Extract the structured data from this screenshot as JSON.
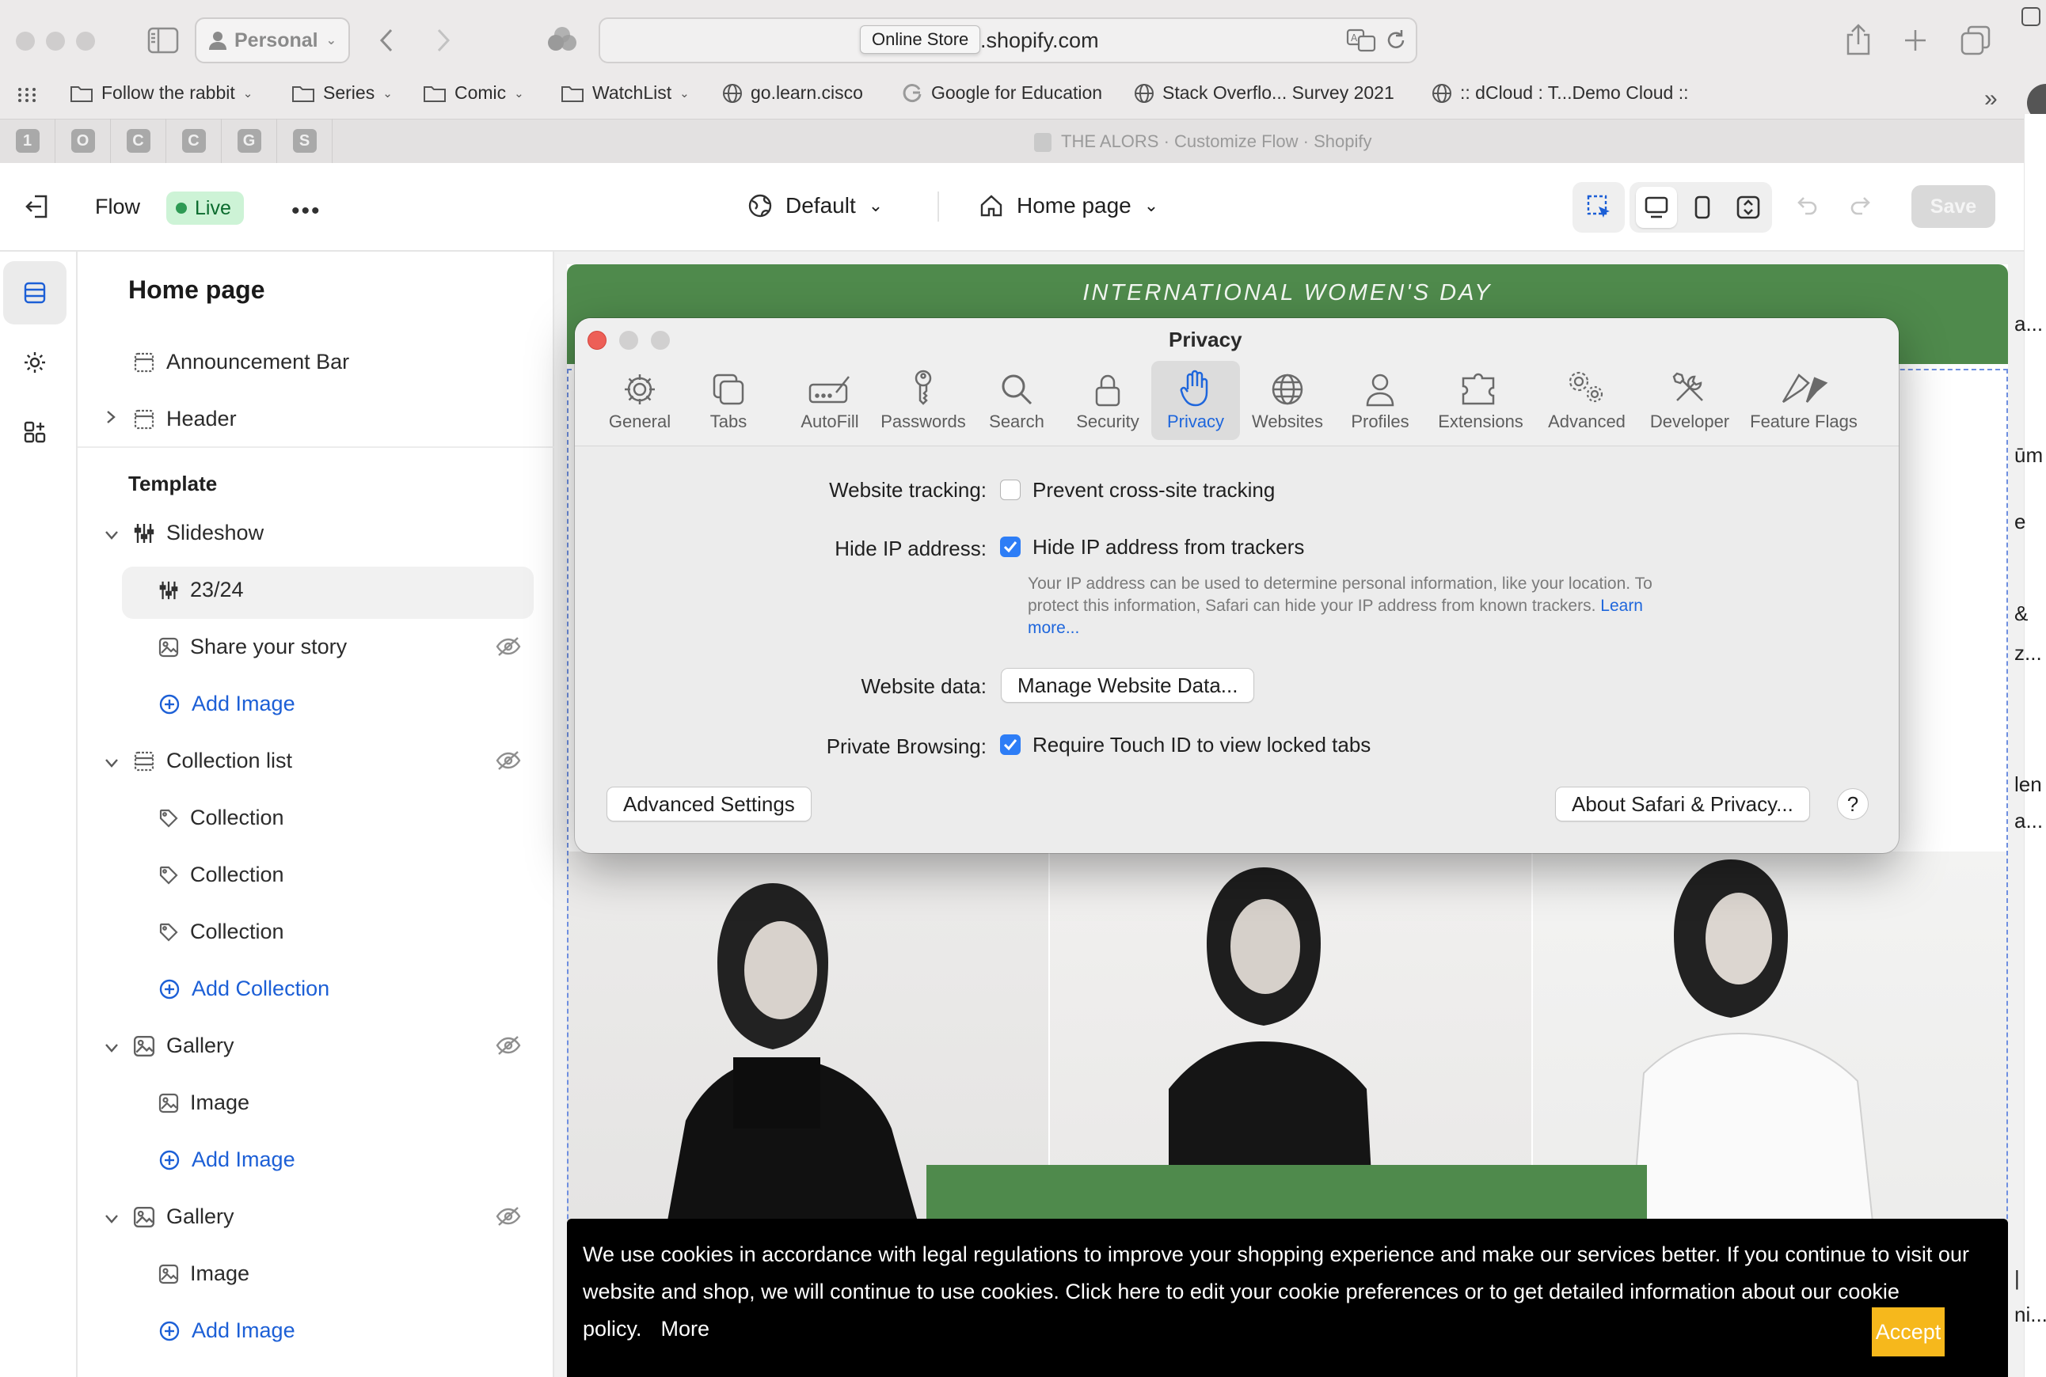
{
  "browser": {
    "profile_label": "Personal",
    "url": ".shopify.com",
    "tooltip": "Online Store",
    "tab_title": "THE ALORS · Customize Flow · Shopify",
    "bookmarks": [
      {
        "label": "Follow the rabbit",
        "icon": "folder-icon",
        "has_menu": true
      },
      {
        "label": "Series",
        "icon": "folder-icon",
        "has_menu": true
      },
      {
        "label": "Comic",
        "icon": "folder-icon",
        "has_menu": true
      },
      {
        "label": "WatchList",
        "icon": "folder-icon",
        "has_menu": true
      },
      {
        "label": "go.learn.cisco",
        "icon": "globe-icon",
        "has_menu": false
      },
      {
        "label": "Google for Education",
        "icon": "google-icon",
        "has_menu": false
      },
      {
        "label": "Stack Overflo... Survey 2021",
        "icon": "globe-icon",
        "has_menu": false
      },
      {
        "label": ":: dCloud : T...Demo Cloud ::",
        "icon": "globe-icon",
        "has_menu": false
      }
    ],
    "pinned_tabs": [
      "1",
      "O",
      "C",
      "C",
      "G",
      "S"
    ]
  },
  "editor_bar": {
    "theme_name": "Flow",
    "status": "Live",
    "locale": "Default",
    "page": "Home page",
    "save_label": "Save"
  },
  "sidebar": {
    "title": "Home page",
    "header_items": [
      {
        "label": "Announcement Bar"
      },
      {
        "label": "Header"
      }
    ],
    "template_label": "Template",
    "items": {
      "slideshow": "Slideshow",
      "slide_1": "23/24",
      "slide_2": "Share your story",
      "add_image_1": "Add Image",
      "collection_list": "Collection list",
      "collection_1": "Collection",
      "collection_2": "Collection",
      "collection_3": "Collection",
      "add_collection": "Add Collection",
      "gallery_1": "Gallery",
      "gallery_1_image": "Image",
      "add_image_2": "Add Image",
      "gallery_2": "Gallery",
      "gallery_2_image": "Image",
      "add_image_3": "Add Image"
    }
  },
  "preview": {
    "announcement": "INTERNATIONAL WOMEN'S DAY",
    "cookie_text": "We use cookies in accordance with legal regulations to improve your shopping experience and make our services better. If you continue to visit our website and shop, we will continue to use cookies. Click here to edit your cookie preferences or to get detailed information about our cookie policy.",
    "cookie_more": "More",
    "cookie_accept": "Accept",
    "accent_green": "#4f8a4c",
    "accent_yellow": "#f6b81c"
  },
  "dialog": {
    "title": "Privacy",
    "tabs": [
      {
        "label": "General",
        "icon": "gear-icon"
      },
      {
        "label": "Tabs",
        "icon": "tabs-icon"
      },
      {
        "label": "AutoFill",
        "icon": "autofill-icon"
      },
      {
        "label": "Passwords",
        "icon": "key-icon"
      },
      {
        "label": "Search",
        "icon": "search-icon"
      },
      {
        "label": "Security",
        "icon": "lock-icon"
      },
      {
        "label": "Privacy",
        "icon": "hand-icon",
        "active": true
      },
      {
        "label": "Websites",
        "icon": "globe-icon"
      },
      {
        "label": "Profiles",
        "icon": "person-icon"
      },
      {
        "label": "Extensions",
        "icon": "puzzle-icon"
      },
      {
        "label": "Advanced",
        "icon": "gears-icon"
      },
      {
        "label": "Developer",
        "icon": "tools-icon"
      },
      {
        "label": "Feature Flags",
        "icon": "flags-icon"
      }
    ],
    "tracking_label": "Website tracking:",
    "tracking_option": "Prevent cross-site tracking",
    "tracking_checked": false,
    "hide_ip_label": "Hide IP address:",
    "hide_ip_option": "Hide IP address from trackers",
    "hide_ip_checked": true,
    "hide_ip_help": "Your IP address can be used to determine personal information, like your location. To protect this information, Safari can hide your IP address from known trackers.",
    "learn_more": "Learn more...",
    "website_data_label": "Website data:",
    "manage_button": "Manage Website Data...",
    "private_label": "Private Browsing:",
    "private_option": "Require Touch ID to view locked tabs",
    "private_checked": true,
    "advanced_button": "Advanced Settings",
    "about_button": "About Safari & Privacy...",
    "help_button": "?"
  },
  "right_edge_fragments": [
    "a...",
    "ūm",
    "e",
    "&",
    "z...",
    "len",
    "a...",
    "|",
    "ni..."
  ]
}
